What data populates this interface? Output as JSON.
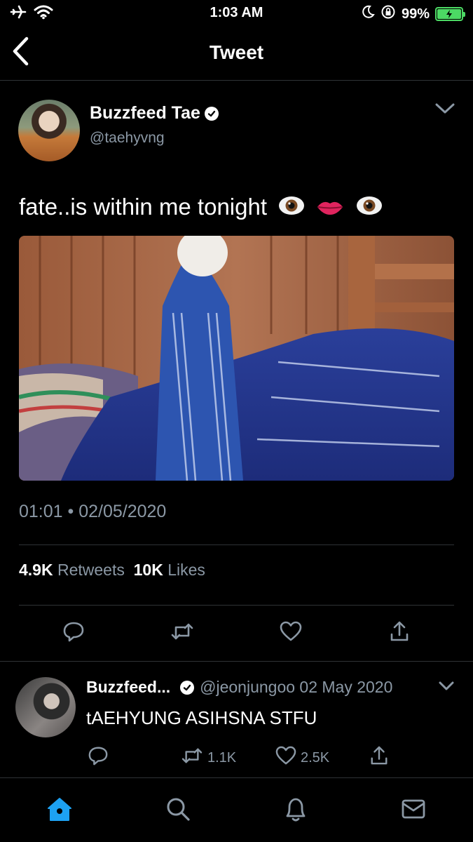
{
  "status_bar": {
    "time": "1:03 AM",
    "battery_percent": "99%",
    "battery_level": 0.99,
    "icons": [
      "airplane-icon",
      "wifi-icon",
      "moon-icon",
      "orientation-lock-icon",
      "battery-icon"
    ]
  },
  "header": {
    "title": "Tweet",
    "back_icon": "chevron-left-icon"
  },
  "tweet": {
    "author_name": "Buzzfeed Tae",
    "handle": "@taehyvng",
    "text": "fate..is within me tonight",
    "emojis": [
      "eye",
      "lips",
      "eye"
    ],
    "timestamp": "01:01 • 02/05/2020",
    "retweets_count": "4.9K",
    "retweets_label": "Retweets",
    "likes_count": "10K",
    "likes_label": "Likes",
    "actions": [
      "reply-icon",
      "retweet-icon",
      "like-icon",
      "share-icon"
    ]
  },
  "reply": {
    "author_name": "Buzzfeed...",
    "handle_date": "@jeonjungoo 02 May 2020",
    "text": "tAEHYUNG ASIHSNA STFU",
    "retweets": "1.1K",
    "likes": "2.5K"
  },
  "tabbar": {
    "items": [
      "home-icon",
      "search-icon",
      "notifications-icon",
      "messages-icon"
    ],
    "active": "home",
    "accent": "#1da1f2"
  },
  "colors": {
    "background": "#000000",
    "secondary_text": "#8b98a5",
    "divider": "#2f3336",
    "battery": "#4cd964"
  }
}
